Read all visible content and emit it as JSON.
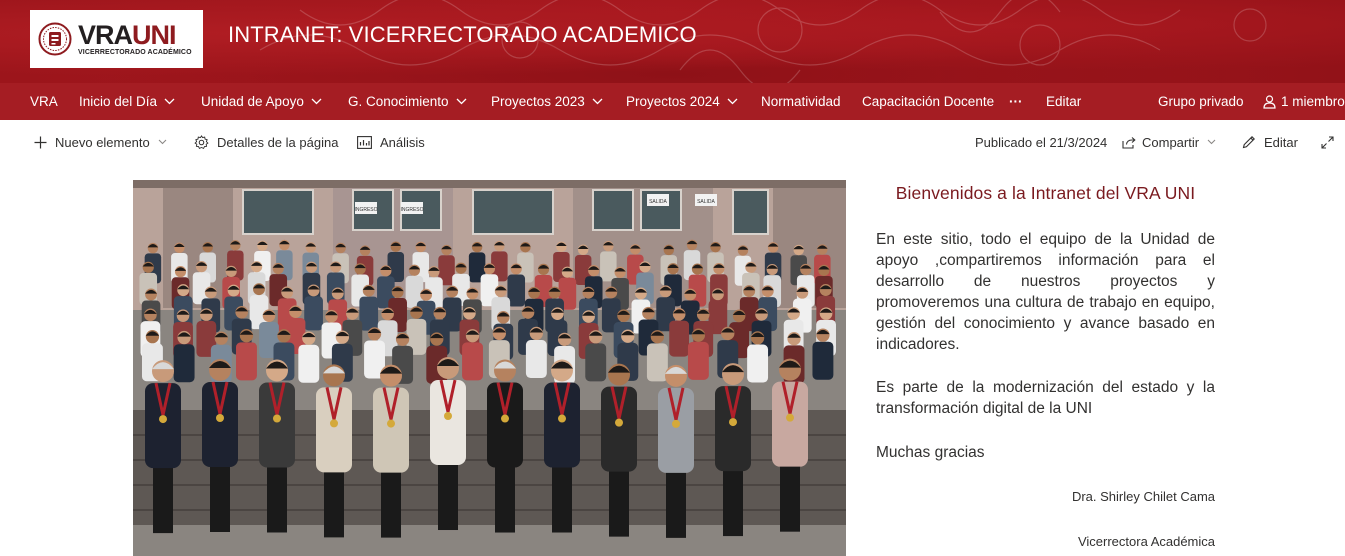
{
  "header": {
    "logo": {
      "text_main_a": "VRA",
      "text_main_b": "UNI",
      "text_sub": "VICERRECTORADO ACADÉMICO"
    },
    "site_title": "INTRANET: VICERRECTORADO ACADEMICO",
    "colors": {
      "banner": "#a5171e",
      "nav": "#a51d23",
      "accent_text": "#7a1a1f"
    }
  },
  "nav": {
    "items": [
      {
        "label": "VRA",
        "dropdown": false
      },
      {
        "label": "Inicio del Día",
        "dropdown": true
      },
      {
        "label": "Unidad de Apoyo",
        "dropdown": true
      },
      {
        "label": "G. Conocimiento",
        "dropdown": true
      },
      {
        "label": "Proyectos 2023",
        "dropdown": true
      },
      {
        "label": "Proyectos 2024",
        "dropdown": true
      },
      {
        "label": "Normatividad",
        "dropdown": false
      },
      {
        "label": "Capacitación Docente",
        "dropdown": false
      },
      {
        "label": "···",
        "dropdown": false
      },
      {
        "label": "Editar",
        "dropdown": false
      }
    ],
    "group_privacy": "Grupo privado",
    "members": "1 miembro"
  },
  "commandbar": {
    "new_item": "Nuevo elemento",
    "page_details": "Detalles de la página",
    "analytics": "Análisis",
    "published": "Publicado el 21/3/2024",
    "share": "Compartir",
    "edit": "Editar"
  },
  "content": {
    "welcome_title": "Bienvenidos a la Intranet del VRA UNI",
    "paragraph_1": "En este sitio, todo el equipo de la Unidad de apoyo ,compartiremos información para el desarrollo de nuestros proyectos y promoveremos una cultura de trabajo en equipo, gestión del conocimiento y avance basado en indicadores.",
    "paragraph_2": "Es parte de la modernización del estado y la transformación digital de la UNI",
    "paragraph_3": "Muchas gracias",
    "signature_name": "Dra. Shirley Chilet Cama",
    "signature_role": "Vicerrectora Académica",
    "image_signs": [
      "INGRESO",
      "INGRESO",
      "SALIDA",
      "SALIDA"
    ]
  }
}
